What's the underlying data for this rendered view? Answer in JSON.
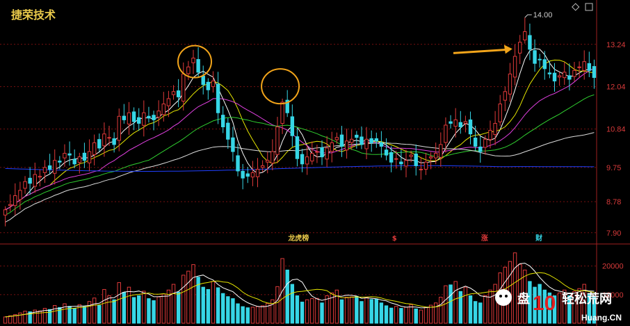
{
  "header": {
    "stock_name": "捷荣技术"
  },
  "colors": {
    "up": "#e03a3a",
    "down": "#36d6e6",
    "ma5": "#ffffff",
    "ma10": "#e6e600",
    "ma20": "#e040e0",
    "ma30": "#30d030",
    "ma60": "#dcdcdc",
    "ma120": "#2040ff",
    "grid": "#7a1010",
    "annotation": "#f2a41a"
  },
  "chart_data": {
    "type": "candlestick",
    "price_axis": {
      "ticks": [
        7.9,
        8.78,
        9.75,
        10.84,
        12.04,
        13.24
      ],
      "labels": [
        "7.90",
        "8.78",
        "9.75",
        "10.84",
        "12.04",
        "13.24"
      ]
    },
    "volume_axis": {
      "ticks": [
        20000,
        10000
      ],
      "labels": [
        "20000",
        "10000"
      ]
    },
    "peak_annotation": {
      "text": "14.00",
      "value": 14.0
    },
    "event_markers": [
      {
        "text": "龙虎榜",
        "color": "#e8c84a"
      },
      {
        "text": "$",
        "color": "#e03a3a"
      },
      {
        "text": "涨",
        "color": "#e03a3a"
      },
      {
        "text": "财",
        "color": "#36d6e6"
      }
    ],
    "annotations": [
      "circle near first high",
      "circle near second high",
      "arrow pointing to 14.00 peak"
    ],
    "watermark": {
      "text_left": "盘",
      "number": "10",
      "text_right": "轻松荒网",
      "url": "Huang.CN"
    },
    "closes": [
      8.55,
      8.7,
      8.95,
      9.1,
      9.35,
      9.3,
      9.55,
      9.5,
      9.75,
      9.7,
      9.95,
      9.9,
      10.15,
      10.1,
      9.85,
      10.05,
      9.95,
      10.2,
      10.45,
      10.3,
      10.7,
      10.6,
      10.4,
      11.2,
      11.1,
      11.3,
      11.05,
      11.0,
      11.3,
      11.15,
      11.1,
      11.35,
      11.55,
      11.7,
      11.9,
      11.75,
      12.4,
      12.6,
      12.85,
      12.45,
      12.1,
      11.95,
      12.2,
      11.3,
      10.9,
      10.55,
      10.2,
      9.65,
      9.45,
      9.5,
      9.6,
      9.7,
      9.8,
      9.95,
      10.2,
      10.9,
      11.6,
      11.3,
      10.65,
      10.0,
      9.85,
      10.05,
      10.15,
      10.2,
      10.05,
      10.3,
      10.45,
      10.6,
      10.35,
      10.5,
      10.55,
      10.6,
      10.4,
      10.55,
      10.45,
      10.5,
      10.35,
      10.1,
      9.9,
      10.0,
      9.85,
      9.95,
      10.1,
      9.8,
      9.7,
      9.9,
      10.05,
      10.15,
      10.4,
      10.95,
      11.0,
      11.1,
      10.9,
      11.05,
      10.7,
      10.35,
      10.2,
      10.55,
      10.8,
      11.0,
      11.55,
      11.9,
      12.4,
      12.9,
      13.3,
      13.6,
      13.1,
      12.7,
      12.8,
      12.55,
      12.4,
      12.2,
      12.35,
      12.45,
      12.25,
      12.5,
      12.6,
      12.75,
      12.5,
      12.3
    ],
    "volumes": [
      2200,
      2600,
      3000,
      3600,
      4200,
      4000,
      4600,
      4300,
      5200,
      4800,
      6200,
      5500,
      6800,
      5900,
      5200,
      6500,
      5800,
      7600,
      8800,
      6200,
      11800,
      9600,
      8200,
      14200,
      10800,
      12600,
      9000,
      9600,
      11200,
      8600,
      7900,
      9200,
      10200,
      11600,
      13600,
      10900,
      16800,
      18200,
      20500,
      16100,
      12600,
      11800,
      14600,
      12400,
      10400,
      9300,
      8600,
      6800,
      5800,
      5400,
      5600,
      5800,
      6100,
      6900,
      8200,
      12800,
      22600,
      18600,
      13600,
      9600,
      7400,
      8200,
      8600,
      8700,
      7100,
      9600,
      10600,
      11600,
      8200,
      9100,
      9200,
      9400,
      7600,
      9100,
      8300,
      8500,
      7100,
      6100,
      5300,
      5900,
      5200,
      5600,
      6500,
      5000,
      4600,
      5500,
      6300,
      7100,
      9100,
      13100,
      13400,
      14600,
      11100,
      12600,
      9600,
      7600,
      7100,
      9600,
      11600,
      13600,
      17600,
      19600,
      21600,
      24600,
      20600,
      18600,
      14600,
      12600,
      13600,
      11600,
      10600,
      9600,
      10600,
      11600,
      9600,
      11100,
      12100,
      13600,
      10100,
      9100
    ]
  }
}
